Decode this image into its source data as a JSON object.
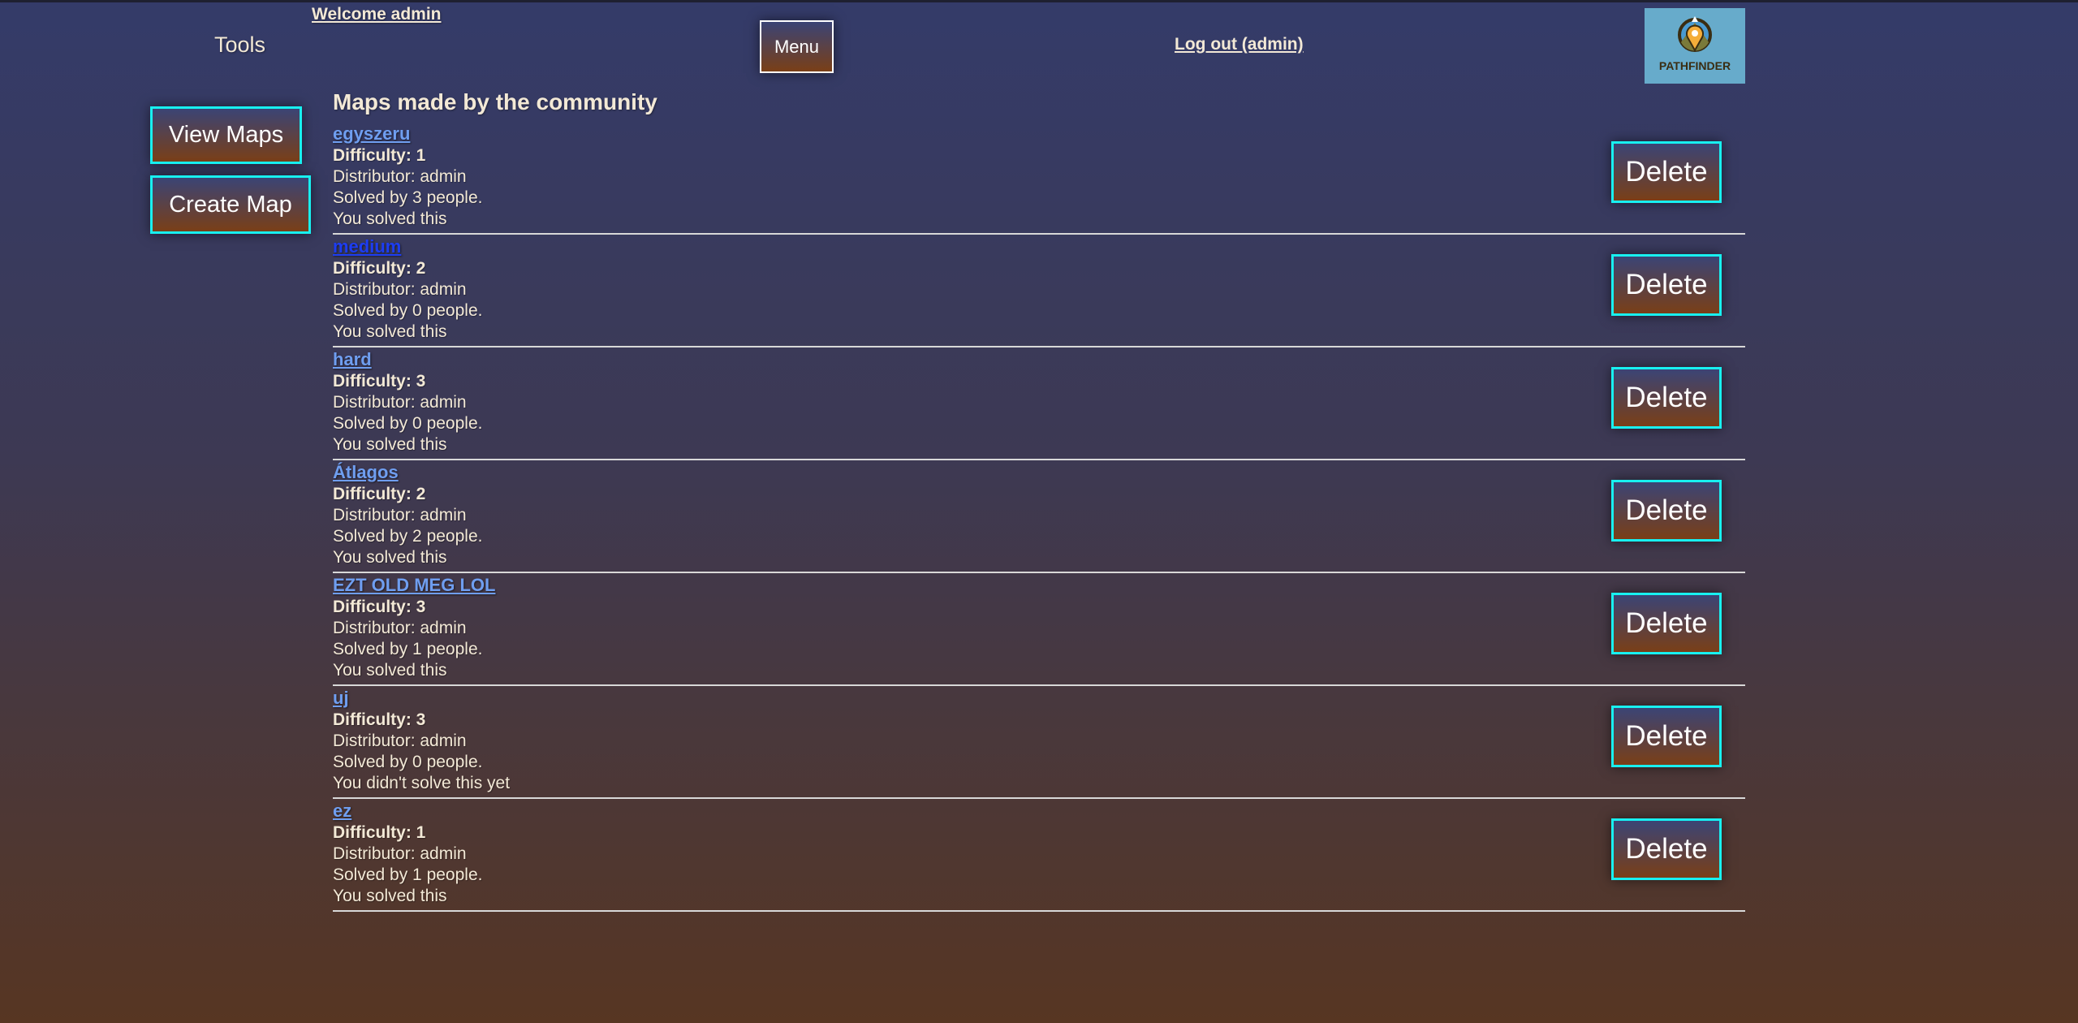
{
  "header": {
    "welcome": "Welcome admin",
    "tools": "Tools",
    "menu": "Menu",
    "logout": "Log out (admin)",
    "logo_text": "PATHFINDER"
  },
  "sidebar": {
    "view_maps": "View Maps",
    "create_map": "Create Map"
  },
  "main": {
    "heading": "Maps made by the community",
    "delete_label": "Delete",
    "maps": [
      {
        "name": "egyszeru",
        "difficulty": "Difficulty: 1",
        "distributor": "Distributor: admin",
        "solved_by": "Solved by 3 people.",
        "status": "You solved this"
      },
      {
        "name": "medium",
        "difficulty": "Difficulty: 2",
        "distributor": "Distributor: admin",
        "solved_by": "Solved by 0 people.",
        "status": "You solved this"
      },
      {
        "name": "hard",
        "difficulty": "Difficulty: 3",
        "distributor": "Distributor: admin",
        "solved_by": "Solved by 0 people.",
        "status": "You solved this"
      },
      {
        "name": "Átlagos",
        "difficulty": "Difficulty: 2",
        "distributor": "Distributor: admin",
        "solved_by": "Solved by 2 people.",
        "status": "You solved this"
      },
      {
        "name": "EZT OLD MEG LOL",
        "difficulty": "Difficulty: 3",
        "distributor": "Distributor: admin",
        "solved_by": "Solved by 1 people.",
        "status": "You solved this"
      },
      {
        "name": "uj",
        "difficulty": "Difficulty: 3",
        "distributor": "Distributor: admin",
        "solved_by": "Solved by 0 people.",
        "status": "You didn't solve this yet"
      },
      {
        "name": "ez",
        "difficulty": "Difficulty: 1",
        "distributor": "Distributor: admin",
        "solved_by": "Solved by 1 people.",
        "status": "You solved this"
      }
    ]
  },
  "colors": {
    "accent_border": "#18f0f0",
    "link": "#6f9ef0",
    "visited_link": "#1d3df2"
  }
}
